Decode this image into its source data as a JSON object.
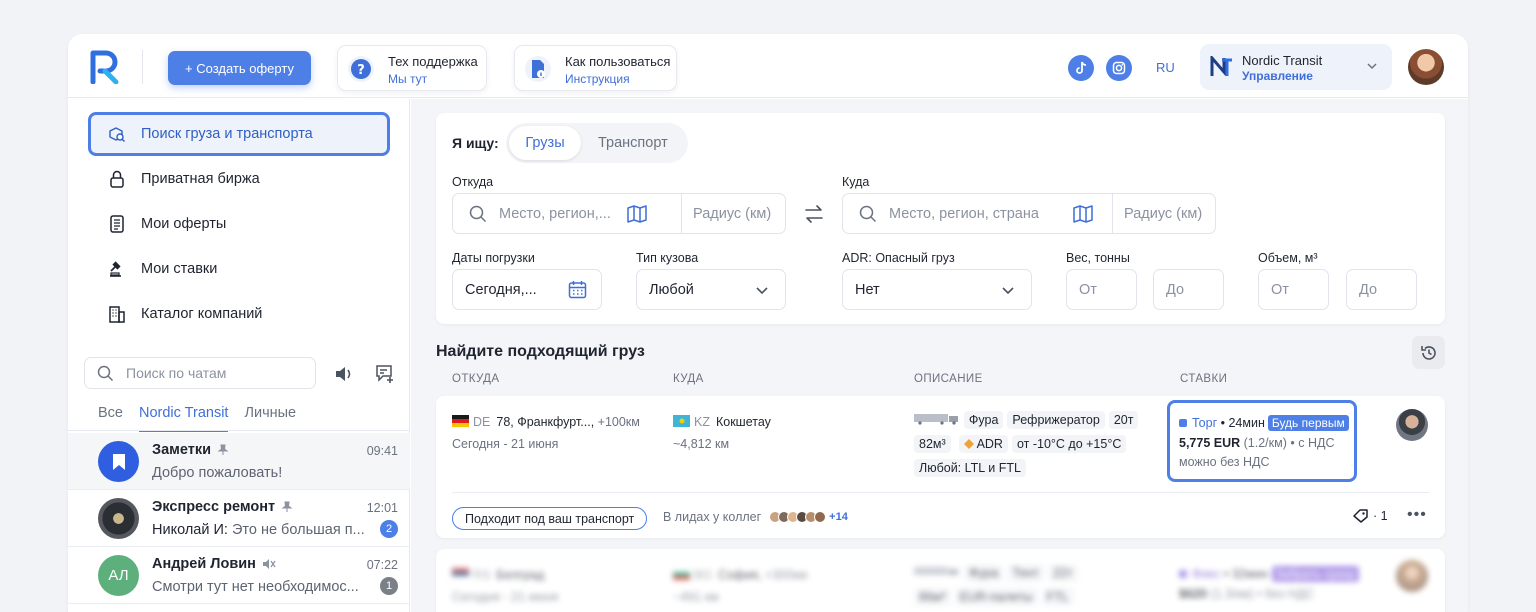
{
  "header": {
    "create_label": "+ Создать оферту",
    "support": {
      "title": "Тех поддержка",
      "sub": "Мы тут"
    },
    "howto": {
      "title": "Как пользоваться",
      "sub": "Инструкция"
    },
    "lang": "RU",
    "org": {
      "name": "Nordic Transit",
      "sub": "Управление"
    }
  },
  "sidebar": {
    "nav": [
      {
        "label": "Поиск груза и транспорта",
        "icon": "cargo-search-icon"
      },
      {
        "label": "Приватная биржа",
        "icon": "lock-icon"
      },
      {
        "label": "Мои оферты",
        "icon": "document-icon"
      },
      {
        "label": "Мои ставки",
        "icon": "gavel-icon"
      },
      {
        "label": "Каталог компаний",
        "icon": "building-icon"
      }
    ],
    "chat_search_placeholder": "Поиск по чатам",
    "tabs": [
      "Все",
      "Nordic Transit",
      "Личные"
    ],
    "chats": [
      {
        "name": "Заметки",
        "msg": "Добро пожаловать!",
        "time": "09:41",
        "badge": "",
        "avatar_color": "#2f5fe0"
      },
      {
        "name": "Экспресс ремонт",
        "sender": "Николай И:",
        "msg": "Это не большая п...",
        "time": "12:01",
        "badge": "2",
        "avatar_color": "#3a3d42"
      },
      {
        "name": "Андрей Ловин",
        "initials": "АЛ",
        "msg": "Смотри тут нет необходимос...",
        "time": "07:22",
        "badge": "1",
        "avatar_color": "#5db07c"
      }
    ]
  },
  "filters": {
    "seek_label": "Я ищу:",
    "mode": [
      "Грузы",
      "Транспорт"
    ],
    "from_label": "Откуда",
    "from_placeholder": "Место, регион,...",
    "radius_placeholder": "Радиус (км)",
    "to_label": "Куда",
    "to_placeholder": "Место, регион, страна",
    "dates_label": "Даты погрузки",
    "dates_value": "Сегодня,...",
    "body_label": "Тип кузова",
    "body_value": "Любой",
    "adr_label": "ADR: Опасный груз",
    "adr_value": "Нет",
    "weight_label": "Вес, тонны",
    "volume_label": "Объем, м³",
    "from_ph": "От",
    "to_ph": "До"
  },
  "results": {
    "title": "Найдите подходящий груз",
    "columns": [
      "ОТКУДА",
      "КУДА",
      "ОПИСАНИЕ",
      "СТАВКИ"
    ],
    "row1": {
      "from_cc": "DE",
      "from_place": "78, Франкфурт...,",
      "from_extra": "+100км",
      "from_date": "Сегодня - 21 июня",
      "to_cc": "KZ",
      "to_place": "Кокшетау",
      "to_dist": "~4,812 км",
      "tags1": [
        "Фура",
        "Рефрижератор",
        "20т"
      ],
      "tags2": [
        "82м³",
        "ADR",
        "от -10°C до +15°C"
      ],
      "tags3": [
        "Любой: LTL и FTL"
      ],
      "rate_type": "Торг",
      "rate_time": "• 24мин",
      "rate_badge": "Будь первым",
      "rate_amount": "5,775 EUR",
      "rate_per_km": "(1.2/км)",
      "rate_vat": "• с НДС",
      "rate_alt": "можно без НДС",
      "match_pill": "Подходит под ваш транспорт",
      "leads_label": "В лидах у коллег",
      "leads_more": "+14",
      "views": "· 1"
    },
    "row2": {
      "from_cc": "RS",
      "from_place": "Белград",
      "from_date": "Сегодня - 21 июня",
      "to_cc": "BG",
      "to_place": "София,",
      "to_extra": "+300км",
      "to_dist": "~491 км",
      "tags1": [
        "Фура",
        "Тент",
        "22т"
      ],
      "tags2": [
        "86м³",
        "EUR-палеты",
        "FTL"
      ],
      "rate_type": "Фикс",
      "rate_time": "• 32мин",
      "rate_badge": "Забрать сразу",
      "rate_amount": "$620",
      "rate_per_km": "(1.3/км)",
      "rate_vat": "• без НДС"
    }
  },
  "colors": {
    "accent": "#4d7fe6",
    "link": "#3f6fd8",
    "badge_gray": "#7b7f88"
  }
}
